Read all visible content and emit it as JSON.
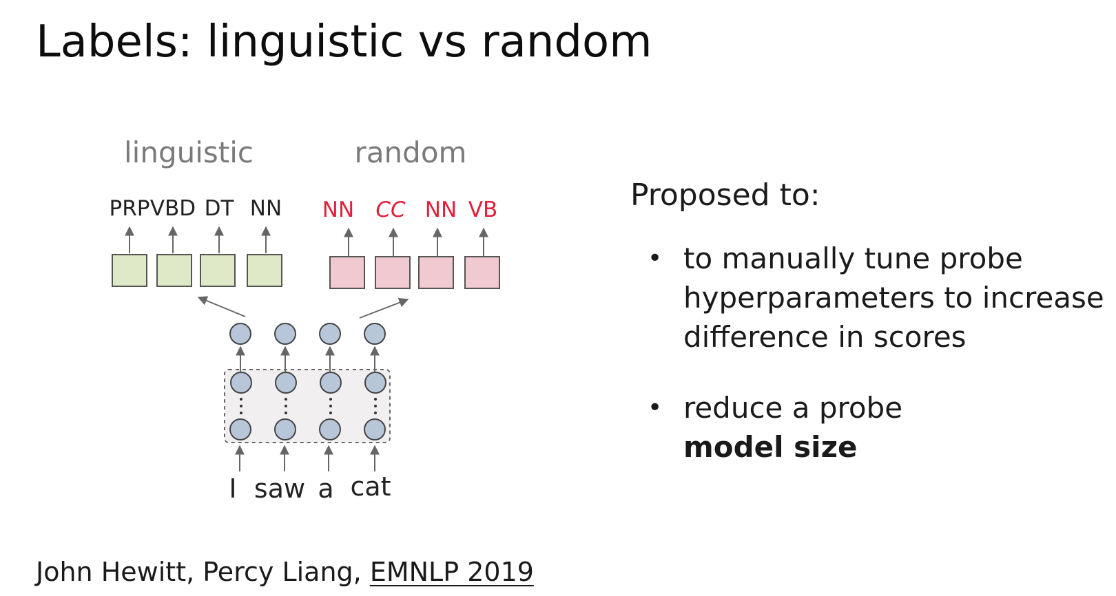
{
  "title": "Labels: linguistic vs random",
  "diagram": {
    "group_labels": {
      "linguistic": "linguistic",
      "random": "random"
    },
    "linguistic_tags": [
      "PRP",
      "VBD",
      "DT",
      "NN"
    ],
    "random_tags": [
      "NN",
      "CC",
      "NN",
      "VB"
    ],
    "sentence_words": [
      "I",
      "saw",
      "a",
      "cat"
    ],
    "colors": {
      "linguistic_box": "#dfe9c7",
      "random_box": "#f1c9d1",
      "random_tag_text": "#e0203c",
      "node_fill": "#b8c6da",
      "tag_text": "#222222",
      "group_label": "#7a7a7a",
      "arrow": "#666666"
    }
  },
  "right_panel": {
    "heading": "Proposed to:",
    "bullet_symbol": "•",
    "bullet_1_lines": [
      "to manually tune probe",
      "hyperparameters to increase",
      "difference in scores"
    ],
    "bullet_2_line_1": "reduce a probe",
    "bullet_2_line_2": "model size"
  },
  "citation": {
    "authors": "John Hewitt, Percy Liang, ",
    "venue": "EMNLP 2019"
  }
}
